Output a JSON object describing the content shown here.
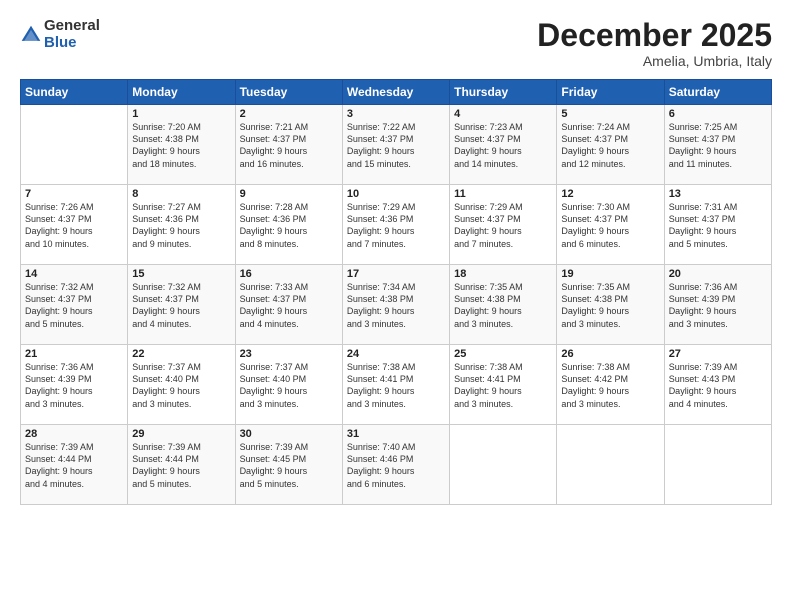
{
  "header": {
    "logo_general": "General",
    "logo_blue": "Blue",
    "month_title": "December 2025",
    "location": "Amelia, Umbria, Italy"
  },
  "columns": [
    "Sunday",
    "Monday",
    "Tuesday",
    "Wednesday",
    "Thursday",
    "Friday",
    "Saturday"
  ],
  "weeks": [
    [
      {
        "day": "",
        "text": ""
      },
      {
        "day": "1",
        "text": "Sunrise: 7:20 AM\nSunset: 4:38 PM\nDaylight: 9 hours\nand 18 minutes."
      },
      {
        "day": "2",
        "text": "Sunrise: 7:21 AM\nSunset: 4:37 PM\nDaylight: 9 hours\nand 16 minutes."
      },
      {
        "day": "3",
        "text": "Sunrise: 7:22 AM\nSunset: 4:37 PM\nDaylight: 9 hours\nand 15 minutes."
      },
      {
        "day": "4",
        "text": "Sunrise: 7:23 AM\nSunset: 4:37 PM\nDaylight: 9 hours\nand 14 minutes."
      },
      {
        "day": "5",
        "text": "Sunrise: 7:24 AM\nSunset: 4:37 PM\nDaylight: 9 hours\nand 12 minutes."
      },
      {
        "day": "6",
        "text": "Sunrise: 7:25 AM\nSunset: 4:37 PM\nDaylight: 9 hours\nand 11 minutes."
      }
    ],
    [
      {
        "day": "7",
        "text": "Sunrise: 7:26 AM\nSunset: 4:37 PM\nDaylight: 9 hours\nand 10 minutes."
      },
      {
        "day": "8",
        "text": "Sunrise: 7:27 AM\nSunset: 4:36 PM\nDaylight: 9 hours\nand 9 minutes."
      },
      {
        "day": "9",
        "text": "Sunrise: 7:28 AM\nSunset: 4:36 PM\nDaylight: 9 hours\nand 8 minutes."
      },
      {
        "day": "10",
        "text": "Sunrise: 7:29 AM\nSunset: 4:36 PM\nDaylight: 9 hours\nand 7 minutes."
      },
      {
        "day": "11",
        "text": "Sunrise: 7:29 AM\nSunset: 4:37 PM\nDaylight: 9 hours\nand 7 minutes."
      },
      {
        "day": "12",
        "text": "Sunrise: 7:30 AM\nSunset: 4:37 PM\nDaylight: 9 hours\nand 6 minutes."
      },
      {
        "day": "13",
        "text": "Sunrise: 7:31 AM\nSunset: 4:37 PM\nDaylight: 9 hours\nand 5 minutes."
      }
    ],
    [
      {
        "day": "14",
        "text": "Sunrise: 7:32 AM\nSunset: 4:37 PM\nDaylight: 9 hours\nand 5 minutes."
      },
      {
        "day": "15",
        "text": "Sunrise: 7:32 AM\nSunset: 4:37 PM\nDaylight: 9 hours\nand 4 minutes."
      },
      {
        "day": "16",
        "text": "Sunrise: 7:33 AM\nSunset: 4:37 PM\nDaylight: 9 hours\nand 4 minutes."
      },
      {
        "day": "17",
        "text": "Sunrise: 7:34 AM\nSunset: 4:38 PM\nDaylight: 9 hours\nand 3 minutes."
      },
      {
        "day": "18",
        "text": "Sunrise: 7:35 AM\nSunset: 4:38 PM\nDaylight: 9 hours\nand 3 minutes."
      },
      {
        "day": "19",
        "text": "Sunrise: 7:35 AM\nSunset: 4:38 PM\nDaylight: 9 hours\nand 3 minutes."
      },
      {
        "day": "20",
        "text": "Sunrise: 7:36 AM\nSunset: 4:39 PM\nDaylight: 9 hours\nand 3 minutes."
      }
    ],
    [
      {
        "day": "21",
        "text": "Sunrise: 7:36 AM\nSunset: 4:39 PM\nDaylight: 9 hours\nand 3 minutes."
      },
      {
        "day": "22",
        "text": "Sunrise: 7:37 AM\nSunset: 4:40 PM\nDaylight: 9 hours\nand 3 minutes."
      },
      {
        "day": "23",
        "text": "Sunrise: 7:37 AM\nSunset: 4:40 PM\nDaylight: 9 hours\nand 3 minutes."
      },
      {
        "day": "24",
        "text": "Sunrise: 7:38 AM\nSunset: 4:41 PM\nDaylight: 9 hours\nand 3 minutes."
      },
      {
        "day": "25",
        "text": "Sunrise: 7:38 AM\nSunset: 4:41 PM\nDaylight: 9 hours\nand 3 minutes."
      },
      {
        "day": "26",
        "text": "Sunrise: 7:38 AM\nSunset: 4:42 PM\nDaylight: 9 hours\nand 3 minutes."
      },
      {
        "day": "27",
        "text": "Sunrise: 7:39 AM\nSunset: 4:43 PM\nDaylight: 9 hours\nand 4 minutes."
      }
    ],
    [
      {
        "day": "28",
        "text": "Sunrise: 7:39 AM\nSunset: 4:44 PM\nDaylight: 9 hours\nand 4 minutes."
      },
      {
        "day": "29",
        "text": "Sunrise: 7:39 AM\nSunset: 4:44 PM\nDaylight: 9 hours\nand 5 minutes."
      },
      {
        "day": "30",
        "text": "Sunrise: 7:39 AM\nSunset: 4:45 PM\nDaylight: 9 hours\nand 5 minutes."
      },
      {
        "day": "31",
        "text": "Sunrise: 7:40 AM\nSunset: 4:46 PM\nDaylight: 9 hours\nand 6 minutes."
      },
      {
        "day": "",
        "text": ""
      },
      {
        "day": "",
        "text": ""
      },
      {
        "day": "",
        "text": ""
      }
    ]
  ]
}
